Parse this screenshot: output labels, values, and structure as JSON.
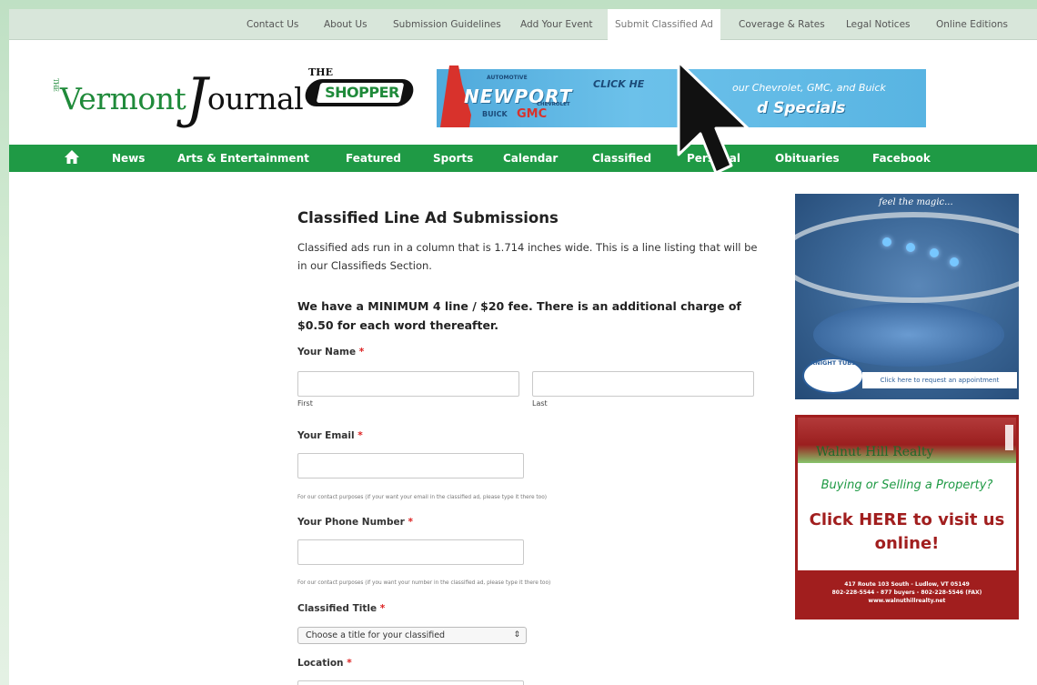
{
  "topnav": {
    "items": [
      "Contact Us",
      "About Us",
      "Submission Guidelines",
      "Add Your Event",
      "Submit Classified Ad",
      "Coverage & Rates",
      "Legal Notices",
      "Online Editions"
    ],
    "active": "Submit Classified Ad"
  },
  "header": {
    "logo_the": "THE",
    "logo_vermont": "Vermont",
    "logo_j": "J",
    "logo_ournal": "ournal",
    "shopper_the": "THE",
    "shopper_text": "SHOPPER",
    "banner": {
      "auto": "AUTOMOTIVE",
      "newport": "NEWPORT",
      "chevrolet": "CHEVROLET",
      "buick": "BUICK",
      "gmc": "GMC",
      "click": "CLICK HE",
      "your": "our Chevrolet, GMC, and Buick",
      "specials": "d Specials"
    }
  },
  "mainnav": {
    "home_icon": "home-icon",
    "items": [
      "News",
      "Arts & Entertainment",
      "Featured",
      "Sports",
      "Calendar",
      "Classified",
      "Personal",
      "Obituaries",
      "Facebook"
    ]
  },
  "form": {
    "title": "Classified Line Ad Submissions",
    "intro": "Classified ads run in a column that is 1.714 inches wide. This is a line listing that will be in our Classifieds Section.",
    "fee": "We have a MINIMUM 4 line / $20 fee. There is an additional charge of $0.50 for each word thereafter.",
    "name_label": "Your Name",
    "first_sub": "First",
    "last_sub": "Last",
    "email_label": "Your Email",
    "email_hint": "For our contact purposes (if your want your email in the classified ad, please type it there too)",
    "phone_label": "Your Phone Number",
    "phone_hint": "For our contact purposes (if you want your number in the classified ad, please type it there too)",
    "title_label": "Classified Title",
    "title_select": "Choose a title for your classified",
    "location_label": "Location",
    "required_mark": "*"
  },
  "sidebar": {
    "ad1": {
      "tagline": "feel the magic...",
      "brand": "KNIGHT TUBS",
      "cta": "Click here to request an appointment"
    },
    "ad2": {
      "brand": "Walnut Hill Realty",
      "headline": "Buying or Selling a Property?",
      "cta": "Click HERE to visit us online!",
      "address": "417 Route 103 South - Ludlow, VT 05149",
      "phones": "802-228-5544 - 877 buyers - 802-228-5546 (FAX)",
      "web": "www.walnuthillrealty.net"
    }
  },
  "colors": {
    "brand_green": "#1f9a45",
    "topnav_bg": "#d8e6da",
    "required_red": "#dd2222",
    "realty_red": "#a11e1e"
  }
}
